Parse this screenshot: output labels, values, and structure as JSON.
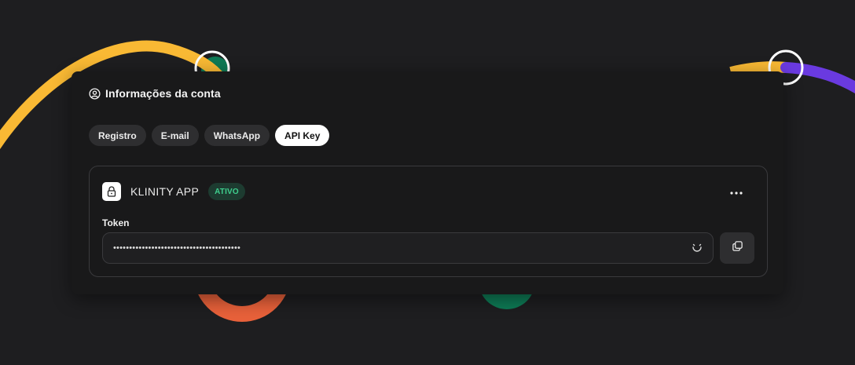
{
  "card": {
    "title": "Informações da conta",
    "title_icon": "user-circle-icon"
  },
  "tabs": [
    {
      "label": "Registro",
      "active": false
    },
    {
      "label": "E-mail",
      "active": false
    },
    {
      "label": "WhatsApp",
      "active": false
    },
    {
      "label": "API Key",
      "active": true
    }
  ],
  "app": {
    "name": "KLINITY APP",
    "status": "ATIVO",
    "icon": "lock-icon",
    "menu_icon": "more-horizontal-icon"
  },
  "token": {
    "label": "Token",
    "value": "••••••••••••••••••••••••••••••••••••••••",
    "regenerate_icon": "refresh-icon",
    "copy_icon": "copy-icon"
  },
  "colors": {
    "background": "#1e1e20",
    "card": "#19191a",
    "badge_bg": "#1d3b30",
    "badge_text": "#3fcf8e",
    "accent_yellow": "#f9b934",
    "accent_purple": "#6a3ae0",
    "accent_orange": "#e8613a",
    "accent_green": "#0e7a55"
  }
}
